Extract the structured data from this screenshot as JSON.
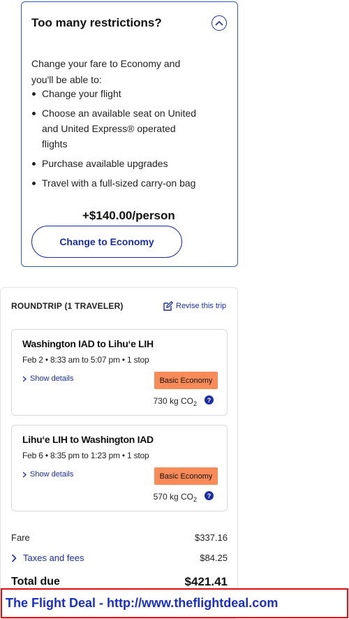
{
  "restrictions": {
    "title": "Too many restrictions?",
    "intro": "Change your fare to Economy and you'll be able to:",
    "benefits": [
      "Change your flight",
      "Choose an available seat on United and United Express® operated flights",
      "Purchase available upgrades",
      "Travel with a full-sized carry-on bag"
    ],
    "price_per_person": "+$140.00/person",
    "change_button": "Change to Economy",
    "collapse_icon": "chevron-up-circle-icon"
  },
  "trip": {
    "heading": "ROUNDTRIP (1 TRAVELER)",
    "revise_link": "Revise this trip",
    "flights": [
      {
        "route": "Washington IAD to Lihuʻe LIH",
        "times": "Feb 2 • 8:33 am to 5:07 pm • 1 stop",
        "show_details": "Show details",
        "fare_class": "Basic Economy",
        "co2_value": "730 kg CO",
        "co2_sub": "2",
        "help": "?"
      },
      {
        "route": "Lihuʻe LIH to Washington IAD",
        "times": "Feb 6 • 8:35 pm to 1:23 pm • 1 stop",
        "show_details": "Show details",
        "fare_class": "Basic Economy",
        "co2_value": "570 kg CO",
        "co2_sub": "2",
        "help": "?"
      }
    ],
    "pricing": {
      "fare_label": "Fare",
      "fare_value": "$337.16",
      "taxes_label": "Taxes and fees",
      "taxes_value": "$84.25",
      "total_label": "Total due",
      "total_value": "$421.41"
    }
  },
  "watermark": "The Flight Deal - http://www.theflightdeal.com",
  "colors": {
    "accent": "#1a2ea6",
    "badge": "#f98b58",
    "watermark_border": "#e01010"
  }
}
